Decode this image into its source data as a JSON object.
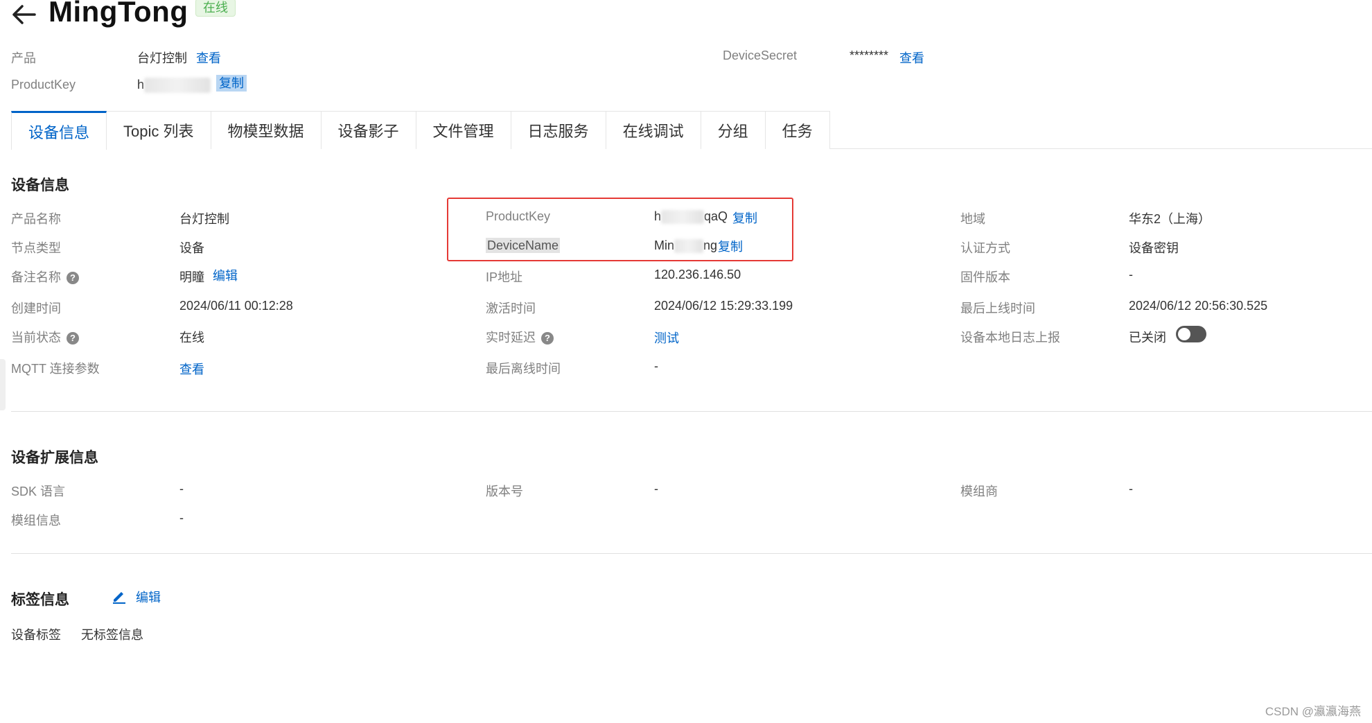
{
  "header": {
    "title": "MingTong",
    "status": "在线"
  },
  "meta": {
    "product_label": "产品",
    "product_value": "台灯控制",
    "product_view": "查看",
    "productkey_label": "ProductKey",
    "productkey_value": "h",
    "productkey_copy": "复制",
    "secret_label": "DeviceSecret",
    "secret_value": "********",
    "secret_view": "查看"
  },
  "tabs": [
    {
      "label": "设备信息",
      "active": true
    },
    {
      "label": "Topic 列表"
    },
    {
      "label": "物模型数据"
    },
    {
      "label": "设备影子"
    },
    {
      "label": "文件管理"
    },
    {
      "label": "日志服务"
    },
    {
      "label": "在线调试"
    },
    {
      "label": "分组"
    },
    {
      "label": "任务"
    }
  ],
  "device_info": {
    "title": "设备信息",
    "col1": [
      {
        "label": "产品名称",
        "value": "台灯控制"
      },
      {
        "label": "节点类型",
        "value": "设备"
      },
      {
        "label": "备注名称",
        "value": "明瞳",
        "action": "编辑"
      },
      {
        "label": "创建时间",
        "value": "2024/06/11 00:12:28"
      },
      {
        "label": "当前状态",
        "value": "在线"
      },
      {
        "label": "MQTT 连接参数",
        "action": "查看"
      }
    ],
    "col2": [
      {
        "label": "ProductKey",
        "value_start": "h",
        "value_end": "qaQ",
        "action": "复制"
      },
      {
        "label": "DeviceName",
        "value_start": "Min",
        "value_end": "ng",
        "action": "复制"
      },
      {
        "label": "IP地址",
        "value": "120.236.146.50"
      },
      {
        "label": "激活时间",
        "value": "2024/06/12 15:29:33.199"
      },
      {
        "label": "实时延迟",
        "action": "测试"
      },
      {
        "label": "最后离线时间",
        "value": "-"
      }
    ],
    "col3": [
      {
        "label": "地域",
        "value": "华东2（上海）"
      },
      {
        "label": "认证方式",
        "value": "设备密钥"
      },
      {
        "label": "固件版本",
        "value": "-"
      },
      {
        "label": "最后上线时间",
        "value": "2024/06/12 20:56:30.525"
      },
      {
        "label": "设备本地日志上报",
        "value": "已关闭",
        "toggle_on": false
      }
    ]
  },
  "ext_info": {
    "title": "设备扩展信息",
    "sdk_label": "SDK 语言",
    "sdk_value": "-",
    "version_label": "版本号",
    "version_value": "-",
    "vendor_label": "模组商",
    "vendor_value": "-",
    "module_label": "模组信息",
    "module_value": "-"
  },
  "tag_info": {
    "title": "标签信息",
    "edit": "编辑",
    "tag_label": "设备标签",
    "tag_value": "无标签信息"
  },
  "watermark": "CSDN @瀛瀛海燕",
  "colors": {
    "link": "#0064c8",
    "highlight_box": "#e53935",
    "status_tag_bg": "#e8f6e4"
  }
}
